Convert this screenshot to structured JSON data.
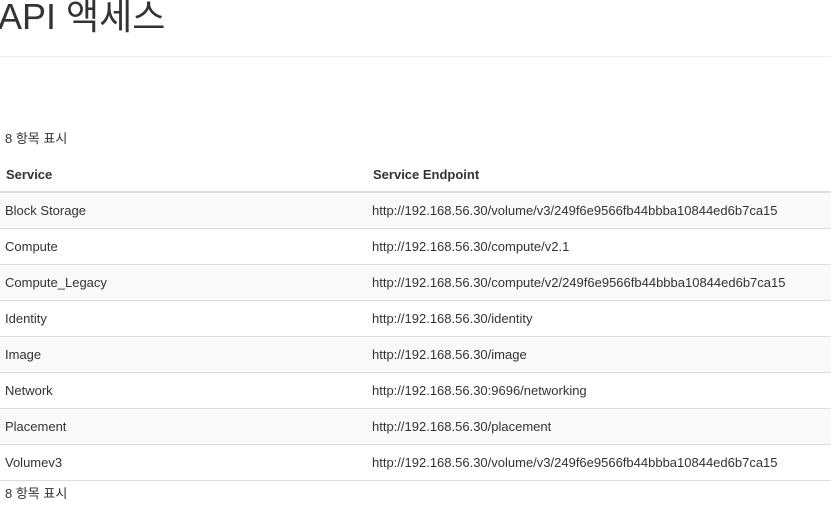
{
  "page": {
    "title": "API 액세스"
  },
  "table": {
    "item_count_label": "8 항목 표시",
    "headers": {
      "service": "Service",
      "endpoint": "Service Endpoint"
    },
    "rows": [
      {
        "service": "Block Storage",
        "endpoint": "http://192.168.56.30/volume/v3/249f6e9566fb44bbba10844ed6b7ca15"
      },
      {
        "service": "Compute",
        "endpoint": "http://192.168.56.30/compute/v2.1"
      },
      {
        "service": "Compute_Legacy",
        "endpoint": "http://192.168.56.30/compute/v2/249f6e9566fb44bbba10844ed6b7ca15"
      },
      {
        "service": "Identity",
        "endpoint": "http://192.168.56.30/identity"
      },
      {
        "service": "Image",
        "endpoint": "http://192.168.56.30/image"
      },
      {
        "service": "Network",
        "endpoint": "http://192.168.56.30:9696/networking"
      },
      {
        "service": "Placement",
        "endpoint": "http://192.168.56.30/placement"
      },
      {
        "service": "Volumev3",
        "endpoint": "http://192.168.56.30/volume/v3/249f6e9566fb44bbba10844ed6b7ca15"
      }
    ]
  }
}
